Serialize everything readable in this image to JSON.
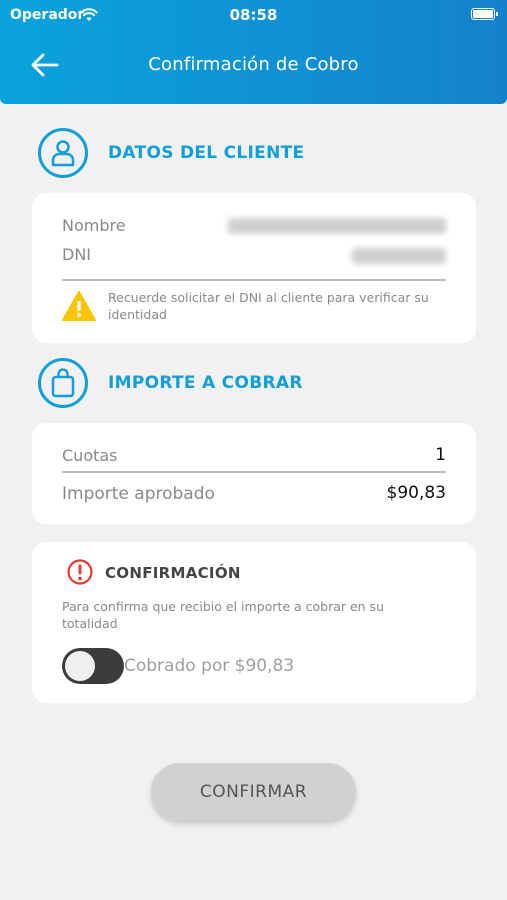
{
  "status_bar": {
    "carrier": "Operador",
    "time": "08:58"
  },
  "header": {
    "title": "Confirmación de Cobro"
  },
  "cliente": {
    "section_title": "DATOS DEL CLIENTE",
    "nombre_label": "Nombre",
    "dni_label": "DNI",
    "warning": "Recuerde solicitar el DNI al cliente para verificar su identidad"
  },
  "importe": {
    "section_title": "IMPORTE A COBRAR",
    "cuotas_label": "Cuotas",
    "cuotas_value": "1",
    "aprobado_label": "Importe aprobado",
    "aprobado_value": "$90,83"
  },
  "confirmacion": {
    "title": "CONFIRMACIÓN",
    "description": "Para confirma que recibio el importe a cobrar en su totalidad",
    "toggle_label": "Cobrado por $90,83",
    "toggle_on": false
  },
  "confirm_button": "CONFIRMAR",
  "colors": {
    "accent": "#129fd8",
    "warning": "#f7c600",
    "alert": "#e53935"
  }
}
